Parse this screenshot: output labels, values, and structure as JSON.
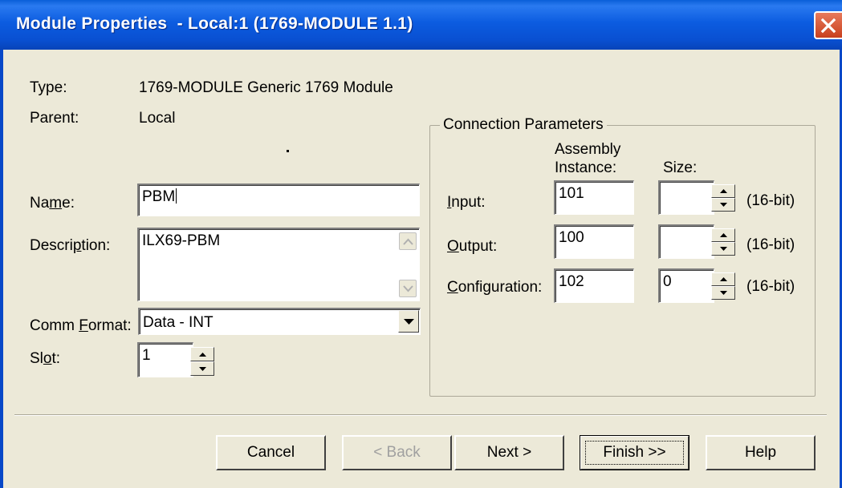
{
  "window": {
    "title": "Module Properties  - Local:1 (1769-MODULE 1.1)"
  },
  "info": {
    "type_label": "Type:",
    "type_value": "1769-MODULE Generic 1769 Module",
    "parent_label": "Parent:",
    "parent_value": "Local"
  },
  "form": {
    "name": {
      "pre": "Na",
      "ul": "m",
      "post": "e:",
      "value": "PBM"
    },
    "description": {
      "pre": "Descri",
      "ul": "p",
      "post": "tion:",
      "value": "ILX69-PBM"
    },
    "comm_format": {
      "pre": "Comm ",
      "ul": "F",
      "post": "ormat:",
      "value": "Data - INT"
    },
    "slot": {
      "pre": "Sl",
      "ul": "o",
      "post": "t:",
      "value": "1"
    }
  },
  "connection": {
    "caption": "Connection Parameters",
    "col_assembly_line1": "Assembly",
    "col_assembly_line2": "Instance:",
    "col_size": "Size:",
    "rows": [
      {
        "pre": "",
        "ul": "I",
        "post": "nput:",
        "instance": "101",
        "size": "",
        "unit": "(16-bit)"
      },
      {
        "pre": "",
        "ul": "O",
        "post": "utput:",
        "instance": "100",
        "size": "",
        "unit": "(16-bit)"
      },
      {
        "pre": "",
        "ul": "C",
        "post": "onfiguration:",
        "instance": "102",
        "size": "0",
        "unit": "(16-bit)"
      }
    ]
  },
  "buttons": {
    "cancel": "Cancel",
    "back": "< Back",
    "next": "Next >",
    "finish": "Finish >>",
    "help": "Help"
  },
  "icons": [
    "close-icon",
    "scroll-up-icon",
    "scroll-down-icon",
    "dropdown-arrow-icon",
    "spin-up-icon",
    "spin-down-icon"
  ],
  "colors": {
    "titlebar": "#0a5fd8",
    "dialog_bg": "#ece9d8",
    "close_button": "#d9552f"
  }
}
